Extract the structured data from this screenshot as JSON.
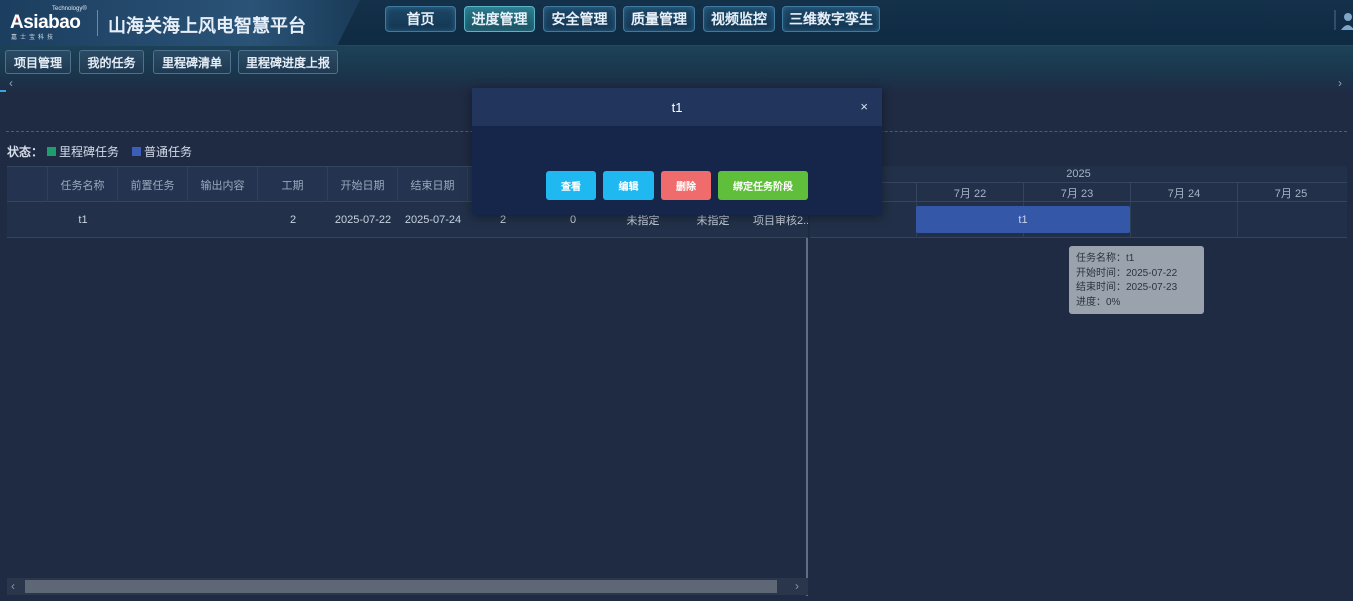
{
  "header": {
    "logo_text": "Asiabao",
    "logo_tech": "Technology®",
    "logo_sub": "嘉士宝科技",
    "app_title": "山海关海上风电智慧平台",
    "nav": [
      {
        "label": "首页"
      },
      {
        "label": "进度管理",
        "active": true
      },
      {
        "label": "安全管理"
      },
      {
        "label": "质量管理"
      },
      {
        "label": "视频监控"
      },
      {
        "label": "三维数字孪生"
      }
    ]
  },
  "subbar": {
    "tabs": [
      {
        "label": "项目管理"
      },
      {
        "label": "我的任务"
      },
      {
        "label": "里程碑清单"
      },
      {
        "label": "里程碑进度上报"
      }
    ]
  },
  "legend": {
    "label": "状态：",
    "items": [
      {
        "label": "里程碑任务",
        "color": "#1f9e6d"
      },
      {
        "label": "普通任务",
        "color": "#3b5fb8"
      }
    ]
  },
  "grid": {
    "columns": [
      "",
      "任务名称",
      "前置任务",
      "输出内容",
      "工期",
      "开始日期",
      "结束日期",
      "",
      "",
      "",
      "",
      ""
    ],
    "rows": [
      {
        "cells": [
          "",
          "t1",
          "",
          "",
          "2",
          "2025-07-22",
          "2025-07-24",
          "2",
          "0",
          "未指定",
          "未指定",
          "项目审核2..."
        ]
      }
    ]
  },
  "gantt": {
    "year": "2025",
    "days": [
      "",
      "7月 22",
      "7月 23",
      "7月 24",
      "7月 25"
    ],
    "bar_label": "t1",
    "bar_color": "#3457a8"
  },
  "tooltip": {
    "lines": [
      "任务名称：t1",
      "开始时间：2025-07-22",
      "结束时间：2025-07-23",
      "进度：0%"
    ]
  },
  "modal": {
    "title": "t1",
    "close": "×",
    "buttons": [
      {
        "label": "查看",
        "color": "#1fb8f0"
      },
      {
        "label": "编辑",
        "color": "#1fb8f0"
      },
      {
        "label": "删除",
        "color": "#f06b6b"
      },
      {
        "label": "绑定任务阶段",
        "color": "#5fbf3a"
      }
    ]
  }
}
